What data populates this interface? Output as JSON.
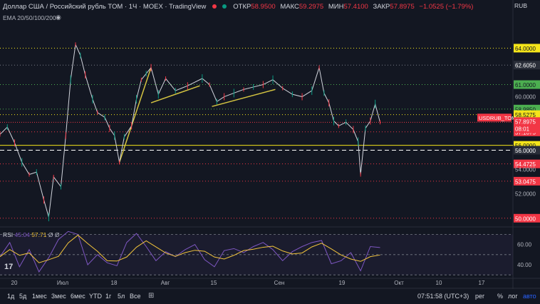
{
  "legend": {
    "title": "Доллар США / Российский рубль TOM · 1Ч · MOEX · TradingView",
    "open_label": "ОТКР",
    "open": "58.9500",
    "high_label": "МАКС",
    "high": "59.2975",
    "low_label": "МИН",
    "low": "57.4100",
    "close_label": "ЗАКР",
    "close": "57.8975",
    "change": "−1.0525 (−1.79%)"
  },
  "ema_label": "EMA 20/50/100/200",
  "rsi_label": {
    "name": "RSI",
    "v1": "45.04",
    "v2": "57.71",
    "z1": "Ø",
    "z2": "Ø"
  },
  "currency": "RUB",
  "toolbar": {
    "timeframes": [
      "1д",
      "5д",
      "1мес",
      "3мес",
      "6мес",
      "YTD",
      "1г",
      "5л",
      "Все"
    ],
    "clock": "07:51:58 (UTC+3)",
    "right": [
      "рег",
      "%",
      "лог",
      "авто"
    ]
  },
  "colors": {
    "background": "#131722",
    "price": "#d1d4dc",
    "red_level": "#f23645",
    "yellow_level": "#f5e51a",
    "green_level": "#4caf50",
    "rsi": "#7e57c2",
    "rsi_ma": "#f2c43b",
    "trend": "#d4c441"
  },
  "chart_data": {
    "type": "line",
    "title": "Доллар США / Российский рубль TOM",
    "xlabel": "",
    "ylabel": "",
    "ylim": [
      49.4,
      66.2
    ],
    "x_ticks": [
      "20",
      "Июл",
      "18",
      "Авг",
      "15",
      "Сен",
      "19",
      "Окт",
      "10",
      "17"
    ],
    "y_ticks": [
      "52.0000",
      "54.0000",
      "60.0000"
    ],
    "price_series": [
      {
        "t": 0,
        "v": 56.9
      },
      {
        "t": 3,
        "v": 57.5
      },
      {
        "t": 6,
        "v": 56.2
      },
      {
        "t": 9,
        "v": 54.6
      },
      {
        "t": 12,
        "v": 53.6
      },
      {
        "t": 15,
        "v": 53.8
      },
      {
        "t": 18,
        "v": 51.5
      },
      {
        "t": 20,
        "v": 50.1
      },
      {
        "t": 22,
        "v": 53.4
      },
      {
        "t": 25,
        "v": 52.6
      },
      {
        "t": 27,
        "v": 56.8
      },
      {
        "t": 29,
        "v": 61.4
      },
      {
        "t": 31,
        "v": 64.3
      },
      {
        "t": 33,
        "v": 63.4
      },
      {
        "t": 35,
        "v": 61.8
      },
      {
        "t": 38,
        "v": 59.8
      },
      {
        "t": 40,
        "v": 58.7
      },
      {
        "t": 43,
        "v": 58.3
      },
      {
        "t": 45,
        "v": 57.4
      },
      {
        "t": 47,
        "v": 56.8
      },
      {
        "t": 49,
        "v": 54.6
      },
      {
        "t": 51,
        "v": 56.7
      },
      {
        "t": 54,
        "v": 57.6
      },
      {
        "t": 56,
        "v": 59.8
      },
      {
        "t": 58,
        "v": 61.4
      },
      {
        "t": 60,
        "v": 61.9
      },
      {
        "t": 62,
        "v": 62.4
      },
      {
        "t": 65,
        "v": 60.2
      },
      {
        "t": 68,
        "v": 61.5
      },
      {
        "t": 72,
        "v": 60.5
      },
      {
        "t": 77,
        "v": 60.9
      },
      {
        "t": 83,
        "v": 61.5
      },
      {
        "t": 86,
        "v": 61.0
      },
      {
        "t": 89,
        "v": 59.6
      },
      {
        "t": 92,
        "v": 60.0
      },
      {
        "t": 96,
        "v": 60.3
      },
      {
        "t": 100,
        "v": 60.6
      },
      {
        "t": 104,
        "v": 60.8
      },
      {
        "t": 108,
        "v": 61.0
      },
      {
        "t": 112,
        "v": 61.4
      },
      {
        "t": 116,
        "v": 60.7
      },
      {
        "t": 120,
        "v": 60.2
      },
      {
        "t": 124,
        "v": 60.0
      },
      {
        "t": 128,
        "v": 60.5
      },
      {
        "t": 131,
        "v": 62.4
      },
      {
        "t": 133,
        "v": 60.3
      },
      {
        "t": 135,
        "v": 59.5
      },
      {
        "t": 137,
        "v": 58.0
      },
      {
        "t": 139,
        "v": 57.6
      },
      {
        "t": 142,
        "v": 57.9
      },
      {
        "t": 145,
        "v": 57.3
      },
      {
        "t": 147,
        "v": 56.3
      },
      {
        "t": 148,
        "v": 53.6
      },
      {
        "t": 150,
        "v": 57.4
      },
      {
        "t": 152,
        "v": 58.0
      },
      {
        "t": 154,
        "v": 59.4
      },
      {
        "t": 156,
        "v": 57.9
      }
    ],
    "price_range": [
      50.1,
      64.3
    ],
    "rsi_series": [
      {
        "t": 0,
        "v": 48
      },
      {
        "t": 4,
        "v": 62
      },
      {
        "t": 8,
        "v": 38
      },
      {
        "t": 12,
        "v": 55
      },
      {
        "t": 16,
        "v": 33
      },
      {
        "t": 20,
        "v": 47
      },
      {
        "t": 24,
        "v": 65
      },
      {
        "t": 28,
        "v": 73
      },
      {
        "t": 32,
        "v": 70
      },
      {
        "t": 36,
        "v": 40
      },
      {
        "t": 40,
        "v": 50
      },
      {
        "t": 44,
        "v": 42
      },
      {
        "t": 48,
        "v": 39
      },
      {
        "t": 52,
        "v": 62
      },
      {
        "t": 56,
        "v": 71
      },
      {
        "t": 60,
        "v": 58
      },
      {
        "t": 64,
        "v": 44
      },
      {
        "t": 68,
        "v": 53
      },
      {
        "t": 72,
        "v": 48
      },
      {
        "t": 76,
        "v": 55
      },
      {
        "t": 80,
        "v": 60
      },
      {
        "t": 84,
        "v": 45
      },
      {
        "t": 88,
        "v": 38
      },
      {
        "t": 92,
        "v": 54
      },
      {
        "t": 96,
        "v": 56
      },
      {
        "t": 100,
        "v": 52
      },
      {
        "t": 104,
        "v": 58
      },
      {
        "t": 108,
        "v": 62
      },
      {
        "t": 112,
        "v": 55
      },
      {
        "t": 116,
        "v": 44
      },
      {
        "t": 120,
        "v": 53
      },
      {
        "t": 124,
        "v": 58
      },
      {
        "t": 128,
        "v": 62
      },
      {
        "t": 132,
        "v": 64
      },
      {
        "t": 136,
        "v": 41
      },
      {
        "t": 140,
        "v": 44
      },
      {
        "t": 144,
        "v": 52
      },
      {
        "t": 148,
        "v": 34
      },
      {
        "t": 152,
        "v": 58
      },
      {
        "t": 156,
        "v": 57
      }
    ],
    "rsi_ylim": [
      28,
      76
    ],
    "rsi_ticks": [
      "60.00",
      "40.00"
    ],
    "trendlines": [
      {
        "t1": 49,
        "v1": 54.6,
        "t2": 62,
        "v2": 62.4
      },
      {
        "t1": 62,
        "v1": 59.5,
        "t2": 82,
        "v2": 60.9
      },
      {
        "t1": 87,
        "v1": 59.2,
        "t2": 113,
        "v2": 60.6
      }
    ],
    "levels": [
      {
        "value": 64.0,
        "label": "64.0000",
        "color": "#f5e51a",
        "style": "dotted"
      },
      {
        "value": 62.605,
        "label": "62.6050",
        "color": "#787b86",
        "style": "dotted"
      },
      {
        "value": 61.0,
        "label": "61.0000",
        "color": "#4caf50",
        "style": "dotted"
      },
      {
        "value": 58.985,
        "label": "58.9850",
        "color": "#4caf50",
        "style": "dotted"
      },
      {
        "value": 58.5275,
        "label": "58.5275",
        "color": "#f5e51a",
        "style": "dotted"
      },
      {
        "value": 57.1075,
        "label": "57.1075",
        "color": "#f23645",
        "style": "dotted"
      },
      {
        "value": 56.0,
        "label": "56.0000",
        "color": "#f5e51a",
        "style": "solid"
      },
      {
        "value": 55.6,
        "label": "56.0000",
        "color": "#ffffff",
        "style": "dashed"
      },
      {
        "value": 54.4725,
        "label": "54.4725",
        "color": "#f23645",
        "style": "dotted"
      },
      {
        "value": 53.0475,
        "label": "53.0475",
        "color": "#f23645",
        "style": "dotted"
      },
      {
        "value": 50.0,
        "label": "50.0000",
        "color": "#f23645",
        "style": "dotted"
      }
    ],
    "current": {
      "value": 57.8975,
      "label": "57.8975",
      "countdown": "08:01",
      "symbol": "USDRUB_TOM"
    }
  }
}
